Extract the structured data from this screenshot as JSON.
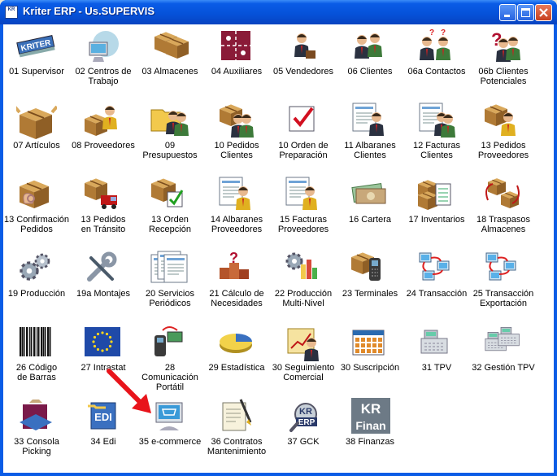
{
  "window": {
    "title": "Kriter ERP - Us.SUPERVIS",
    "app_icon_text": "KR"
  },
  "icons": [
    {
      "label": "01 Supervisor",
      "icon": "kriter-logo-icon"
    },
    {
      "label": "02 Centros de\nTrabajo",
      "icon": "computer-network-icon"
    },
    {
      "label": "03 Almacenes",
      "icon": "boxes-icon"
    },
    {
      "label": "04 Auxiliares",
      "icon": "puzzle-icon"
    },
    {
      "label": "05 Vendedores",
      "icon": "salesman-icon"
    },
    {
      "label": "06 Clientes",
      "icon": "clients-icon"
    },
    {
      "label": "06a Contactos",
      "icon": "contacts-icon"
    },
    {
      "label": "06b Clientes\nPotenciales",
      "icon": "potential-clients-icon"
    },
    {
      "label": "07 Artículos",
      "icon": "open-box-icon"
    },
    {
      "label": "08 Proveedores",
      "icon": "supplier-icon"
    },
    {
      "label": "09 Presupuestos",
      "icon": "folder-people-icon"
    },
    {
      "label": "10 Pedidos\nClientes",
      "icon": "client-orders-icon"
    },
    {
      "label": "10 Orden de\nPreparación",
      "icon": "check-order-icon"
    },
    {
      "label": "11 Albaranes\nClientes",
      "icon": "delivery-note-icon"
    },
    {
      "label": "12 Facturas\nClientes",
      "icon": "invoice-icon"
    },
    {
      "label": "13 Pedidos\nProveedores",
      "icon": "supplier-orders-icon"
    },
    {
      "label": "13 Confirmación\nPedidos",
      "icon": "ok-box-icon"
    },
    {
      "label": "13 Pedidos\nen Tránsito",
      "icon": "truck-icon"
    },
    {
      "label": "13 Orden\nRecepción",
      "icon": "box-check-icon"
    },
    {
      "label": "14 Albaranes\nProveedores",
      "icon": "supplier-delivery-icon"
    },
    {
      "label": "15 Facturas\nProveedores",
      "icon": "supplier-invoice-icon"
    },
    {
      "label": "16 Cartera",
      "icon": "banknotes-icon"
    },
    {
      "label": "17 Inventarios",
      "icon": "inventory-icon"
    },
    {
      "label": "18 Traspasos\nAlmacenes",
      "icon": "transfer-icon"
    },
    {
      "label": "19 Producción",
      "icon": "gears-icon"
    },
    {
      "label": "19a Montajes",
      "icon": "wrench-icon"
    },
    {
      "label": "20 Servicios\nPeriódicos",
      "icon": "documents-icon"
    },
    {
      "label": "21 Cálculo de\nNecesidades",
      "icon": "question-bricks-icon"
    },
    {
      "label": "22 Producción\nMulti-Nivel",
      "icon": "gears-bars-icon"
    },
    {
      "label": "23 Terminales",
      "icon": "handheld-icon"
    },
    {
      "label": "24 Transacción",
      "icon": "network-icon"
    },
    {
      "label": "25 Transacción\nExportación",
      "icon": "network-export-icon"
    },
    {
      "label": "26 Código\nde Barras",
      "icon": "barcode-icon"
    },
    {
      "label": "27 Intrastat",
      "icon": "eu-flag-icon"
    },
    {
      "label": "28 Comunicación\nPortátil",
      "icon": "portable-icon"
    },
    {
      "label": "29 Estadística",
      "icon": "pie-chart-icon"
    },
    {
      "label": "30 Seguimiento\nComercial",
      "icon": "trend-chart-icon"
    },
    {
      "label": "30 Suscripción",
      "icon": "calendar-icon"
    },
    {
      "label": "31 TPV",
      "icon": "cash-register-icon"
    },
    {
      "label": "32 Gestión TPV",
      "icon": "cash-register-network-icon"
    },
    {
      "label": "33 Consola\nPicking",
      "icon": "picking-icon"
    },
    {
      "label": "34 Edi",
      "icon": "edi-icon"
    },
    {
      "label": "35 e-commerce",
      "icon": "ecommerce-icon"
    },
    {
      "label": "36 Contratos\nMantenimiento",
      "icon": "contract-icon"
    },
    {
      "label": "37 GCK",
      "icon": "kr-erp-icon"
    },
    {
      "label": "38 Finanzas",
      "icon": "kr-finan-icon"
    }
  ],
  "icon_texts": {
    "kriter": "KRITER",
    "edi": "EDI",
    "kr": "KR",
    "erp": "ERP",
    "finan": "Finan"
  },
  "colors": {
    "titlebar": "#0a5ce6",
    "client_bg": "#ffffff",
    "arrow": "#e8141b"
  }
}
